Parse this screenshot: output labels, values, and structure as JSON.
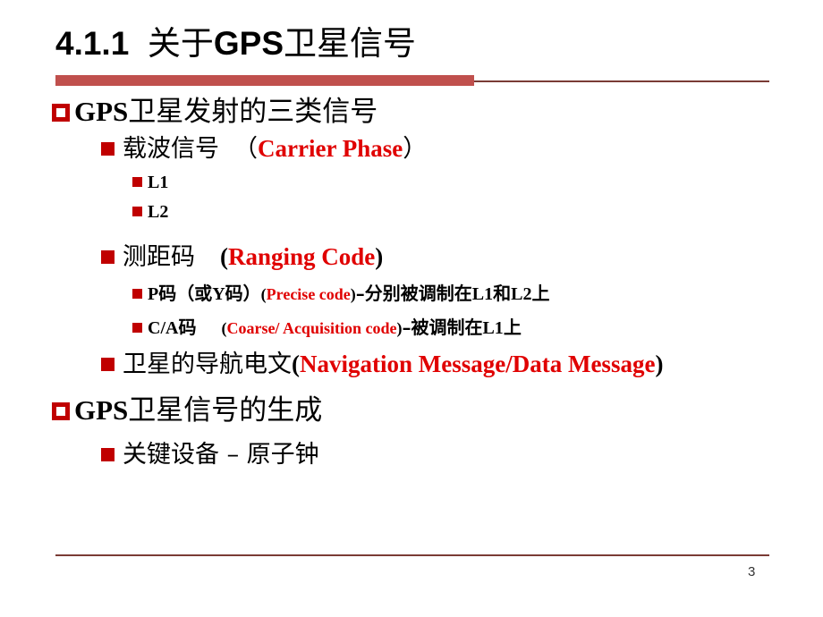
{
  "slide": {
    "title_num": "4.1.1",
    "title_cjk_a": "关于",
    "title_en": "GPS",
    "title_cjk_b": "卫星信号",
    "page_number": "3",
    "accent_color": "#c0504d",
    "rule_color": "#7a3b35",
    "marker_color": "#c00000",
    "highlight_color": "#e00000"
  },
  "content": {
    "item1": {
      "level": 1,
      "marker": "hollow-square-bullet",
      "en": "GPS",
      "cjk": "卫星发射的三类信号"
    },
    "item2": {
      "level": 2,
      "marker": "solid-square-bullet",
      "cjk": "载波信号",
      "paren_open": "（",
      "en_red": "Carrier  Phase",
      "paren_close": "）"
    },
    "item3": {
      "level": 3,
      "marker": "solid-square-bullet",
      "label": "L1"
    },
    "item4": {
      "level": 3,
      "marker": "solid-square-bullet",
      "label": "L2"
    },
    "item5": {
      "level": 2,
      "marker": "solid-square-bullet",
      "cjk": "测距码",
      "paren_open": "(",
      "en_red": "Ranging  Code",
      "paren_close": ")"
    },
    "item6": {
      "level": 3,
      "marker": "solid-square-bullet",
      "code": "P",
      "cjk_a": "码（或",
      "code_b": "Y",
      "cjk_b": "码）",
      "paren_open": "(",
      "en_red": "Precise code",
      "paren_close": ")",
      "dash_cjk": "–分别被调制在",
      "tail_en": "L1",
      "tail_cjk": "和",
      "tail_en2": "L2",
      "tail_cjk2": "上"
    },
    "item7": {
      "level": 3,
      "marker": "solid-square-bullet",
      "code": "C/A",
      "cjk_a": "码",
      "paren_open": "(",
      "en_red": "Coarse/ Acquisition code",
      "paren_close": ")",
      "dash_cjk": "–被调制在",
      "tail_en": "L1",
      "tail_cjk": "上"
    },
    "item8": {
      "level": 2,
      "marker": "solid-square-bullet",
      "cjk": "卫星的导航电文",
      "paren_open": "(",
      "en_red": "Navigation Message/Data Message",
      "paren_close": ")"
    },
    "item9": {
      "level": 1,
      "marker": "hollow-square-bullet",
      "en": "GPS",
      "cjk": "卫星信号的生成"
    },
    "item10": {
      "level": 2,
      "marker": "solid-square-bullet",
      "cjk": "关键设备 – 原子钟"
    }
  }
}
